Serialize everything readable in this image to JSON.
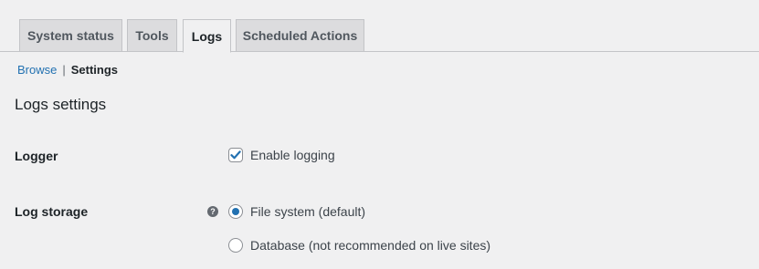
{
  "tabs": [
    {
      "label": "System status",
      "active": false
    },
    {
      "label": "Tools",
      "active": false
    },
    {
      "label": "Logs",
      "active": true
    },
    {
      "label": "Scheduled Actions",
      "active": false
    }
  ],
  "subnav": {
    "browse_label": "Browse",
    "separator": "|",
    "settings_label": "Settings"
  },
  "section_title": "Logs settings",
  "logger": {
    "label": "Logger",
    "enable_logging_label": "Enable logging",
    "enable_logging_checked": true
  },
  "log_storage": {
    "label": "Log storage",
    "help_icon": "?",
    "options": [
      {
        "label": "File system (default)",
        "selected": true
      },
      {
        "label": "Database (not recommended on live sites)",
        "selected": false
      }
    ]
  },
  "colors": {
    "accent": "#2271b1",
    "background": "#f0f0f1",
    "tab_inactive": "#dcdcde"
  }
}
